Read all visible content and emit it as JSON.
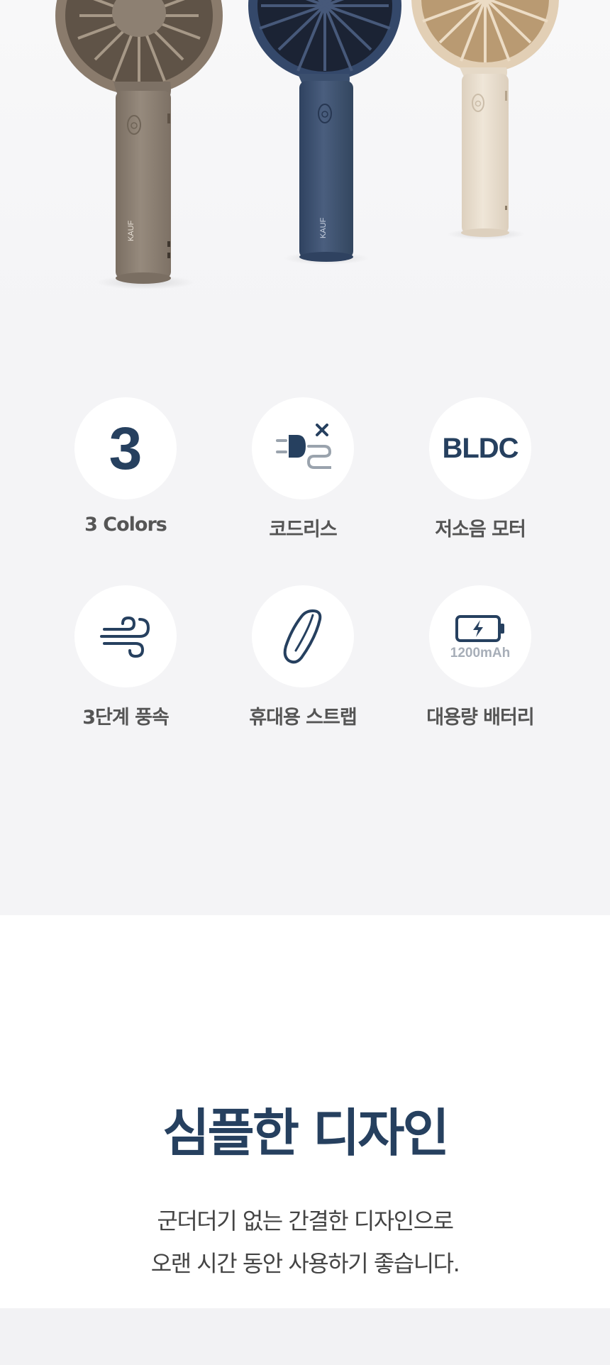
{
  "hero": {
    "brand_text": "KAUF",
    "fans": [
      {
        "color_name": "brown",
        "body": "#8d8174",
        "head": "#8a7b6c"
      },
      {
        "color_name": "navy",
        "body": "#3b4f6e",
        "head": "#34486a"
      },
      {
        "color_name": "beige",
        "body": "#e7dccc",
        "head": "#e2cfb5"
      }
    ]
  },
  "features": {
    "accent": "#26405f",
    "items": [
      {
        "label": "3 Colors",
        "icon": "number-three",
        "icon_text": "3"
      },
      {
        "label": "코드리스",
        "icon": "cordless-plug-icon"
      },
      {
        "label": "저소음 모터",
        "icon": "bldc-text",
        "icon_text": "BLDC"
      },
      {
        "label": "3단계 풍속",
        "icon": "wind-icon"
      },
      {
        "label": "휴대용 스트랩",
        "icon": "strap-icon"
      },
      {
        "label": "대용량 배터리",
        "icon": "battery-icon",
        "icon_text": "1200mAh"
      }
    ]
  },
  "design": {
    "title": "심플한 디자인",
    "desc_line1": "군더더기 없는 간결한 디자인으로",
    "desc_line2": "오랜 시간 동안 사용하기 좋습니다."
  }
}
